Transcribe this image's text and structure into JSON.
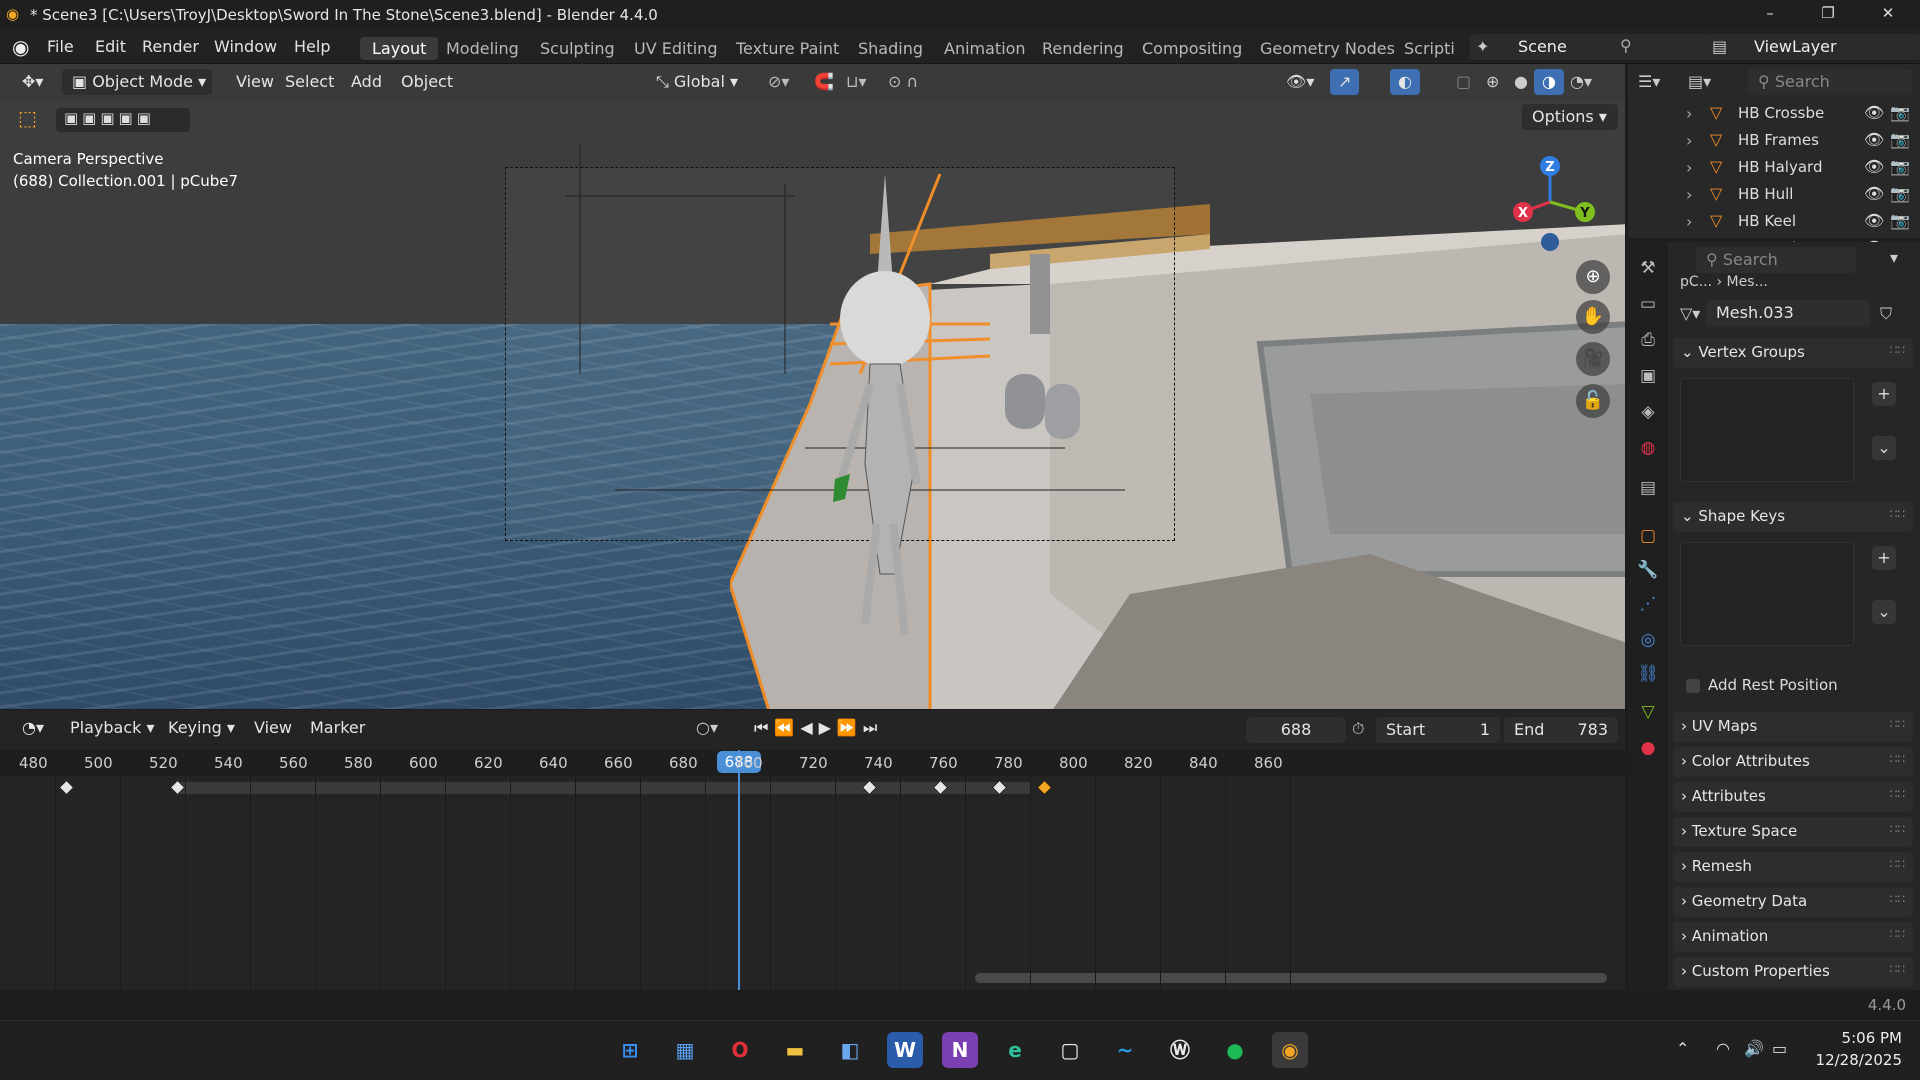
{
  "window": {
    "title": "* Scene3 [C:\\Users\\TroyJ\\Desktop\\Sword In The Stone\\Scene3.blend] - Blender 4.4.0",
    "minimize": "–",
    "maximize": "❐",
    "close": "✕"
  },
  "menu": [
    "File",
    "Edit",
    "Render",
    "Window",
    "Help"
  ],
  "workspaces": [
    "Layout",
    "Modeling",
    "Sculpting",
    "UV Editing",
    "Texture Paint",
    "Shading",
    "Animation",
    "Rendering",
    "Compositing",
    "Geometry Nodes",
    "Scripti"
  ],
  "scene": {
    "name": "Scene",
    "view_layer": "ViewLayer"
  },
  "viewport": {
    "mode": "Object Mode",
    "menus": [
      "View",
      "Select",
      "Add",
      "Object"
    ],
    "transform": "Global",
    "options": "Options",
    "info_line1": "Camera Perspective",
    "info_line2": "(688) Collection.001 | pCube7",
    "gizmo": {
      "x": "X",
      "y": "Y",
      "z": "Z"
    },
    "colors": {
      "x": "#e0334a",
      "y": "#7fbe1e",
      "z": "#2f7de0"
    }
  },
  "outliner": {
    "search_placeholder": "Search",
    "items": [
      "HB Crossbe",
      "HB Frames",
      "HB Halyard",
      "HB Hull",
      "HB Keel",
      "HB Keelson"
    ]
  },
  "properties": {
    "search_placeholder": "Search",
    "breadcrumb_a": "pC...",
    "breadcrumb_b": "Mes...",
    "mesh_name": "Mesh.033",
    "vertex_groups": "Vertex Groups",
    "shape_keys": "Shape Keys",
    "add_rest_position": "Add Rest Position",
    "collapsed_panels": [
      "UV Maps",
      "Color Attributes",
      "Attributes",
      "Texture Space",
      "Remesh",
      "Geometry Data",
      "Animation",
      "Custom Properties"
    ]
  },
  "timeline": {
    "menus": [
      "Playback",
      "Keying",
      "View",
      "Marker"
    ],
    "current_frame": "688",
    "start_label": "Start",
    "start": "1",
    "end_label": "End",
    "end": "783",
    "ticks": [
      "480",
      "500",
      "520",
      "540",
      "560",
      "580",
      "600",
      "620",
      "640",
      "660",
      "680",
      "700",
      "720",
      "740",
      "760",
      "780",
      "800",
      "820",
      "840",
      "860"
    ],
    "keyframes": [
      [
        484,
        false
      ],
      [
        518,
        false
      ],
      [
        731,
        false
      ],
      [
        753,
        false
      ],
      [
        771,
        false
      ],
      [
        785,
        true
      ]
    ]
  },
  "status": {
    "version": "4.4.0"
  },
  "taskbar": {
    "time": "5:06 PM",
    "date": "12/28/2025"
  }
}
